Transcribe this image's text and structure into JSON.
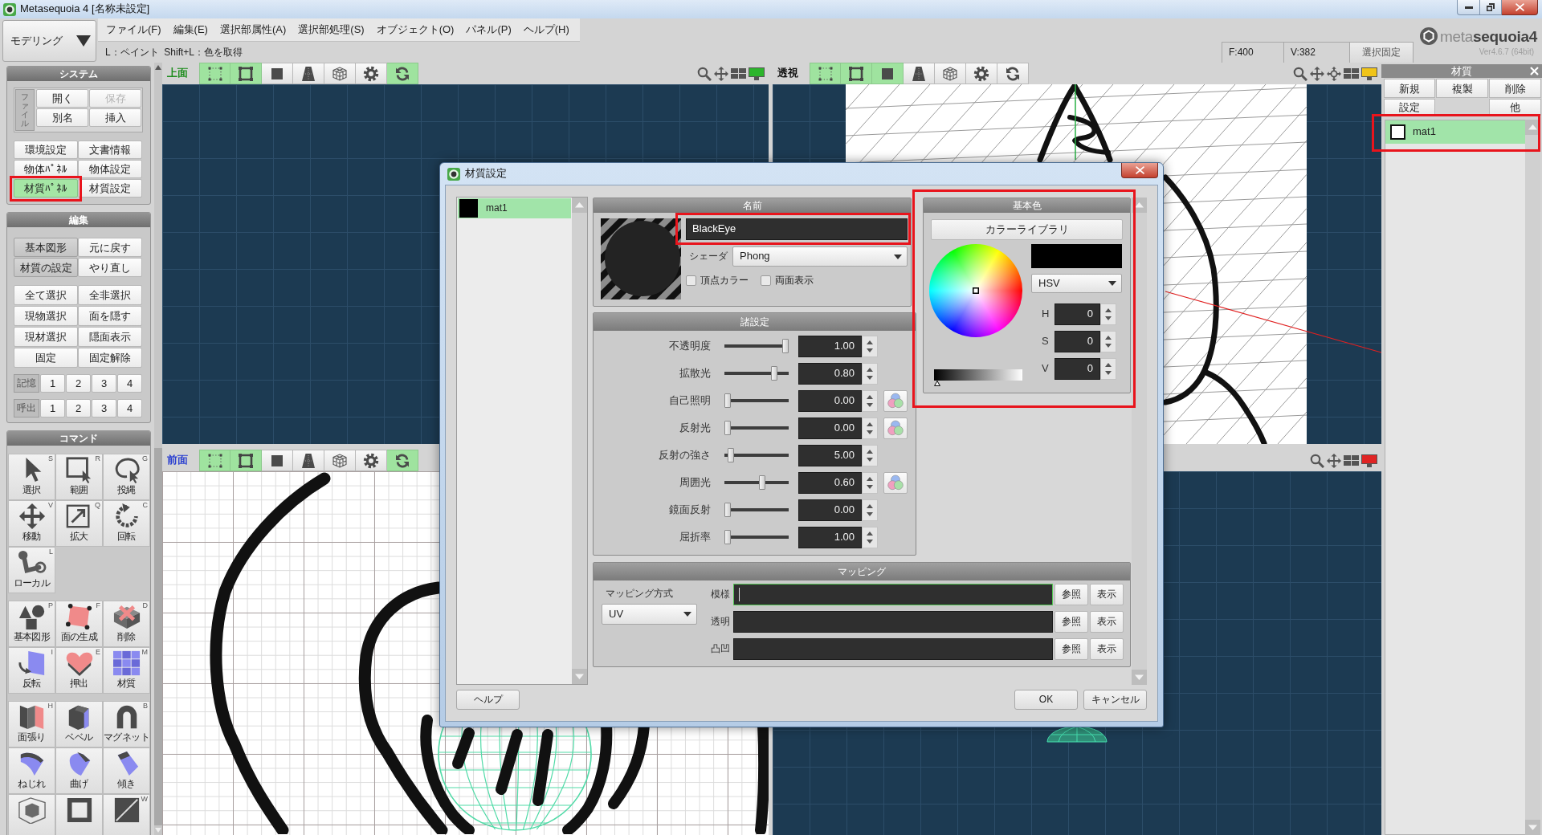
{
  "window": {
    "title": "Metasequoia 4 [名称未設定]"
  },
  "mode_selector": {
    "value": "モデリング"
  },
  "menu": [
    "ファイル(F)",
    "編集(E)",
    "選択部属性(A)",
    "選択部処理(S)",
    "オブジェクト(O)",
    "パネル(P)",
    "ヘルプ(H)"
  ],
  "hint": "L：ペイント  Shift+L：色を取得",
  "status": {
    "faces": "F:400",
    "vertices": "V:382",
    "lock_button": "選択固定"
  },
  "logo": {
    "text": "meta**sequoia4**",
    "version": "Ver4.6.7 (64bit)"
  },
  "left_panel": {
    "system": {
      "title": "システム",
      "file_label": "ファイル",
      "file_buttons": [
        {
          "label": "開く",
          "disabled": false
        },
        {
          "label": "保存",
          "disabled": true
        },
        {
          "label": "別名",
          "disabled": false
        },
        {
          "label": "挿入",
          "disabled": false
        }
      ],
      "buttons": [
        {
          "label": "環境設定",
          "on": false,
          "annotation_frame": false
        },
        {
          "label": "文書情報",
          "on": false,
          "annotation_frame": false
        },
        {
          "label": "物体ﾊﾟﾈﾙ",
          "on": false,
          "annotation_frame": false
        },
        {
          "label": "物体設定",
          "on": false,
          "annotation_frame": false
        },
        {
          "label": "材質ﾊﾟﾈﾙ",
          "on": true,
          "annotation_frame": true
        },
        {
          "label": "材質設定",
          "on": false,
          "annotation_frame": false
        }
      ]
    },
    "edit": {
      "title": "編集",
      "tool_buttons": [
        {
          "label": "基本図形",
          "pressed": true
        },
        {
          "label": "元に戻す",
          "pressed": false
        },
        {
          "label": "材質の設定",
          "pressed": true
        },
        {
          "label": "やり直し",
          "pressed": false
        }
      ],
      "select_buttons": [
        "全て選択",
        "全非選択",
        "現物選択",
        "面を隠す",
        "現材選択",
        "隠面表示",
        "固定",
        "固定解除"
      ],
      "slot_rows": [
        {
          "label": "記憶",
          "slots": [
            "1",
            "2",
            "3",
            "4"
          ]
        },
        {
          "label": "呼出",
          "slots": [
            "1",
            "2",
            "3",
            "4"
          ]
        }
      ]
    },
    "command": {
      "title": "コマンド",
      "groups": [
        [
          {
            "kind": "select",
            "label": "選択",
            "key": "S"
          },
          {
            "kind": "range",
            "label": "範囲",
            "key": "R"
          },
          {
            "kind": "lasso",
            "label": "投縄",
            "key": "G"
          },
          {
            "kind": "move",
            "label": "移動",
            "key": "V"
          },
          {
            "kind": "scale",
            "label": "拡大",
            "key": "Q"
          },
          {
            "kind": "rotate",
            "label": "回転",
            "key": "C"
          },
          {
            "kind": "local",
            "label": "ローカル",
            "key": "L"
          }
        ],
        [
          {
            "kind": "primitive",
            "label": "基本図形",
            "key": "P"
          },
          {
            "kind": "face",
            "label": "面の生成",
            "key": "F"
          },
          {
            "kind": "delete",
            "label": "削除",
            "key": "D"
          },
          {
            "kind": "flip",
            "label": "反転",
            "key": "I"
          },
          {
            "kind": "extrude",
            "label": "押出",
            "key": "E"
          },
          {
            "kind": "material",
            "label": "材質",
            "key": "M"
          }
        ],
        [
          {
            "kind": "stretch",
            "label": "面張り",
            "key": "H"
          },
          {
            "kind": "bevel",
            "label": "ベベル"
          },
          {
            "kind": "magnet",
            "label": "マグネット",
            "key": "B"
          },
          {
            "kind": "twist",
            "label": "ねじれ"
          },
          {
            "kind": "bend",
            "label": "曲げ"
          },
          {
            "kind": "tilt",
            "label": "傾き"
          },
          {
            "kind": "lattice"
          },
          {
            "kind": "frame"
          },
          {
            "kind": "knife",
            "key": "W"
          }
        ]
      ]
    }
  },
  "viewports": [
    {
      "kind": "top_grid",
      "label": "上面",
      "color": "#1c8c1c",
      "toggles": [
        {
          "kind": "points",
          "on": true
        },
        {
          "kind": "frame",
          "on": true
        },
        {
          "kind": "square",
          "on": false
        },
        {
          "kind": "trapezoid",
          "on": false
        },
        {
          "kind": "cube",
          "on": false
        },
        {
          "kind": "gear",
          "on": false
        },
        {
          "kind": "refresh",
          "on": true
        }
      ],
      "tools": [
        {
          "kind": "zoom"
        },
        {
          "kind": "pan"
        },
        {
          "kind": "layout"
        },
        {
          "kind": "monitor",
          "color": "#2cb52c"
        }
      ]
    },
    {
      "kind": "perspective",
      "label": "透視",
      "color": "#111111",
      "toggles": [
        {
          "kind": "points",
          "on": true
        },
        {
          "kind": "frame",
          "on": true
        },
        {
          "kind": "square",
          "on": true
        },
        {
          "kind": "trapezoid",
          "on": false
        },
        {
          "kind": "cube",
          "on": false
        },
        {
          "kind": "gear",
          "on": false
        },
        {
          "kind": "refresh",
          "on": false
        }
      ],
      "tools": [
        {
          "kind": "zoom"
        },
        {
          "kind": "pan"
        },
        {
          "kind": "rotate"
        },
        {
          "kind": "layout"
        },
        {
          "kind": "monitor",
          "color": "#f0c419"
        }
      ]
    },
    {
      "kind": "front_sketch",
      "label": "前面",
      "color": "#2a3fd0",
      "toggles": [
        {
          "kind": "points",
          "on": true
        },
        {
          "kind": "frame",
          "on": true
        },
        {
          "kind": "square",
          "on": false
        },
        {
          "kind": "trapezoid",
          "on": false
        },
        {
          "kind": "cube",
          "on": false
        },
        {
          "kind": "gear",
          "on": false
        },
        {
          "kind": "refresh",
          "on": true
        }
      ]
    },
    {
      "kind": "side_grid",
      "tools": [
        {
          "kind": "zoom"
        },
        {
          "kind": "pan"
        },
        {
          "kind": "layout"
        },
        {
          "kind": "monitor",
          "color": "#e02424"
        }
      ]
    }
  ],
  "right_panel": {
    "title": "材質",
    "buttons": [
      {
        "kind": "button",
        "label": "新規"
      },
      {
        "kind": "button",
        "label": "複製"
      },
      {
        "kind": "button",
        "label": "削除"
      },
      {
        "kind": "button",
        "label": "設定"
      },
      {
        "kind": "blank"
      },
      {
        "kind": "button",
        "label": "他"
      }
    ],
    "annotation_frame": true,
    "materials": [
      {
        "name": "mat1",
        "color": "#ffffff",
        "selected": true
      }
    ]
  },
  "dialog": {
    "title": "材質設定",
    "materials": [
      {
        "name": "mat1",
        "color": "#000000",
        "selected": true
      }
    ],
    "name_panel": {
      "title": "名前",
      "name": "BlackEye",
      "annotation_frame": true,
      "shader_label": "シェーダ",
      "shader": "Phong",
      "options": [
        {
          "label": "頂点カラー",
          "checked": false
        },
        {
          "label": "両面表示",
          "checked": false
        }
      ]
    },
    "color_panel": {
      "title": "基本色",
      "annotation_frame": true,
      "library_button": "カラーライブラリ",
      "color": "#000000",
      "model": "HSV",
      "fields": [
        {
          "label": "H",
          "value": "0"
        },
        {
          "label": "S",
          "value": "0"
        },
        {
          "label": "V",
          "value": "0"
        }
      ],
      "value_slider": {
        "level": 0
      }
    },
    "settings_panel": {
      "title": "諸設定",
      "rows": [
        {
          "label": "不透明度",
          "level": 1,
          "value": "1.00",
          "color_button": false
        },
        {
          "label": "拡散光",
          "level": 0.8,
          "value": "0.80",
          "color_button": false
        },
        {
          "label": "自己照明",
          "level": 0,
          "value": "0.00",
          "color_button": true
        },
        {
          "label": "反射光",
          "level": 0,
          "value": "0.00",
          "color_button": true
        },
        {
          "label": "反射の強さ",
          "level": 0.05,
          "value": "5.00",
          "color_button": false
        },
        {
          "label": "周囲光",
          "level": 0.6,
          "value": "0.60",
          "color_button": true
        },
        {
          "label": "鏡面反射",
          "level": 0,
          "value": "0.00",
          "color_button": false
        },
        {
          "label": "屈折率",
          "level": 0,
          "value": "1.00",
          "color_button": false
        }
      ]
    },
    "mapping_panel": {
      "title": "マッピング",
      "method_label": "マッピング方式",
      "method": "UV",
      "rows": [
        {
          "label": "模様",
          "focused": true,
          "browse_button": "参照",
          "show_button": "表示"
        },
        {
          "label": "透明",
          "focused": false,
          "browse_button": "参照",
          "show_button": "表示"
        },
        {
          "label": "凸凹",
          "focused": false,
          "browse_button": "参照",
          "show_button": "表示"
        }
      ]
    },
    "help_button": "ヘルプ",
    "ok_button": "OK",
    "cancel_button": "キャンセル"
  }
}
